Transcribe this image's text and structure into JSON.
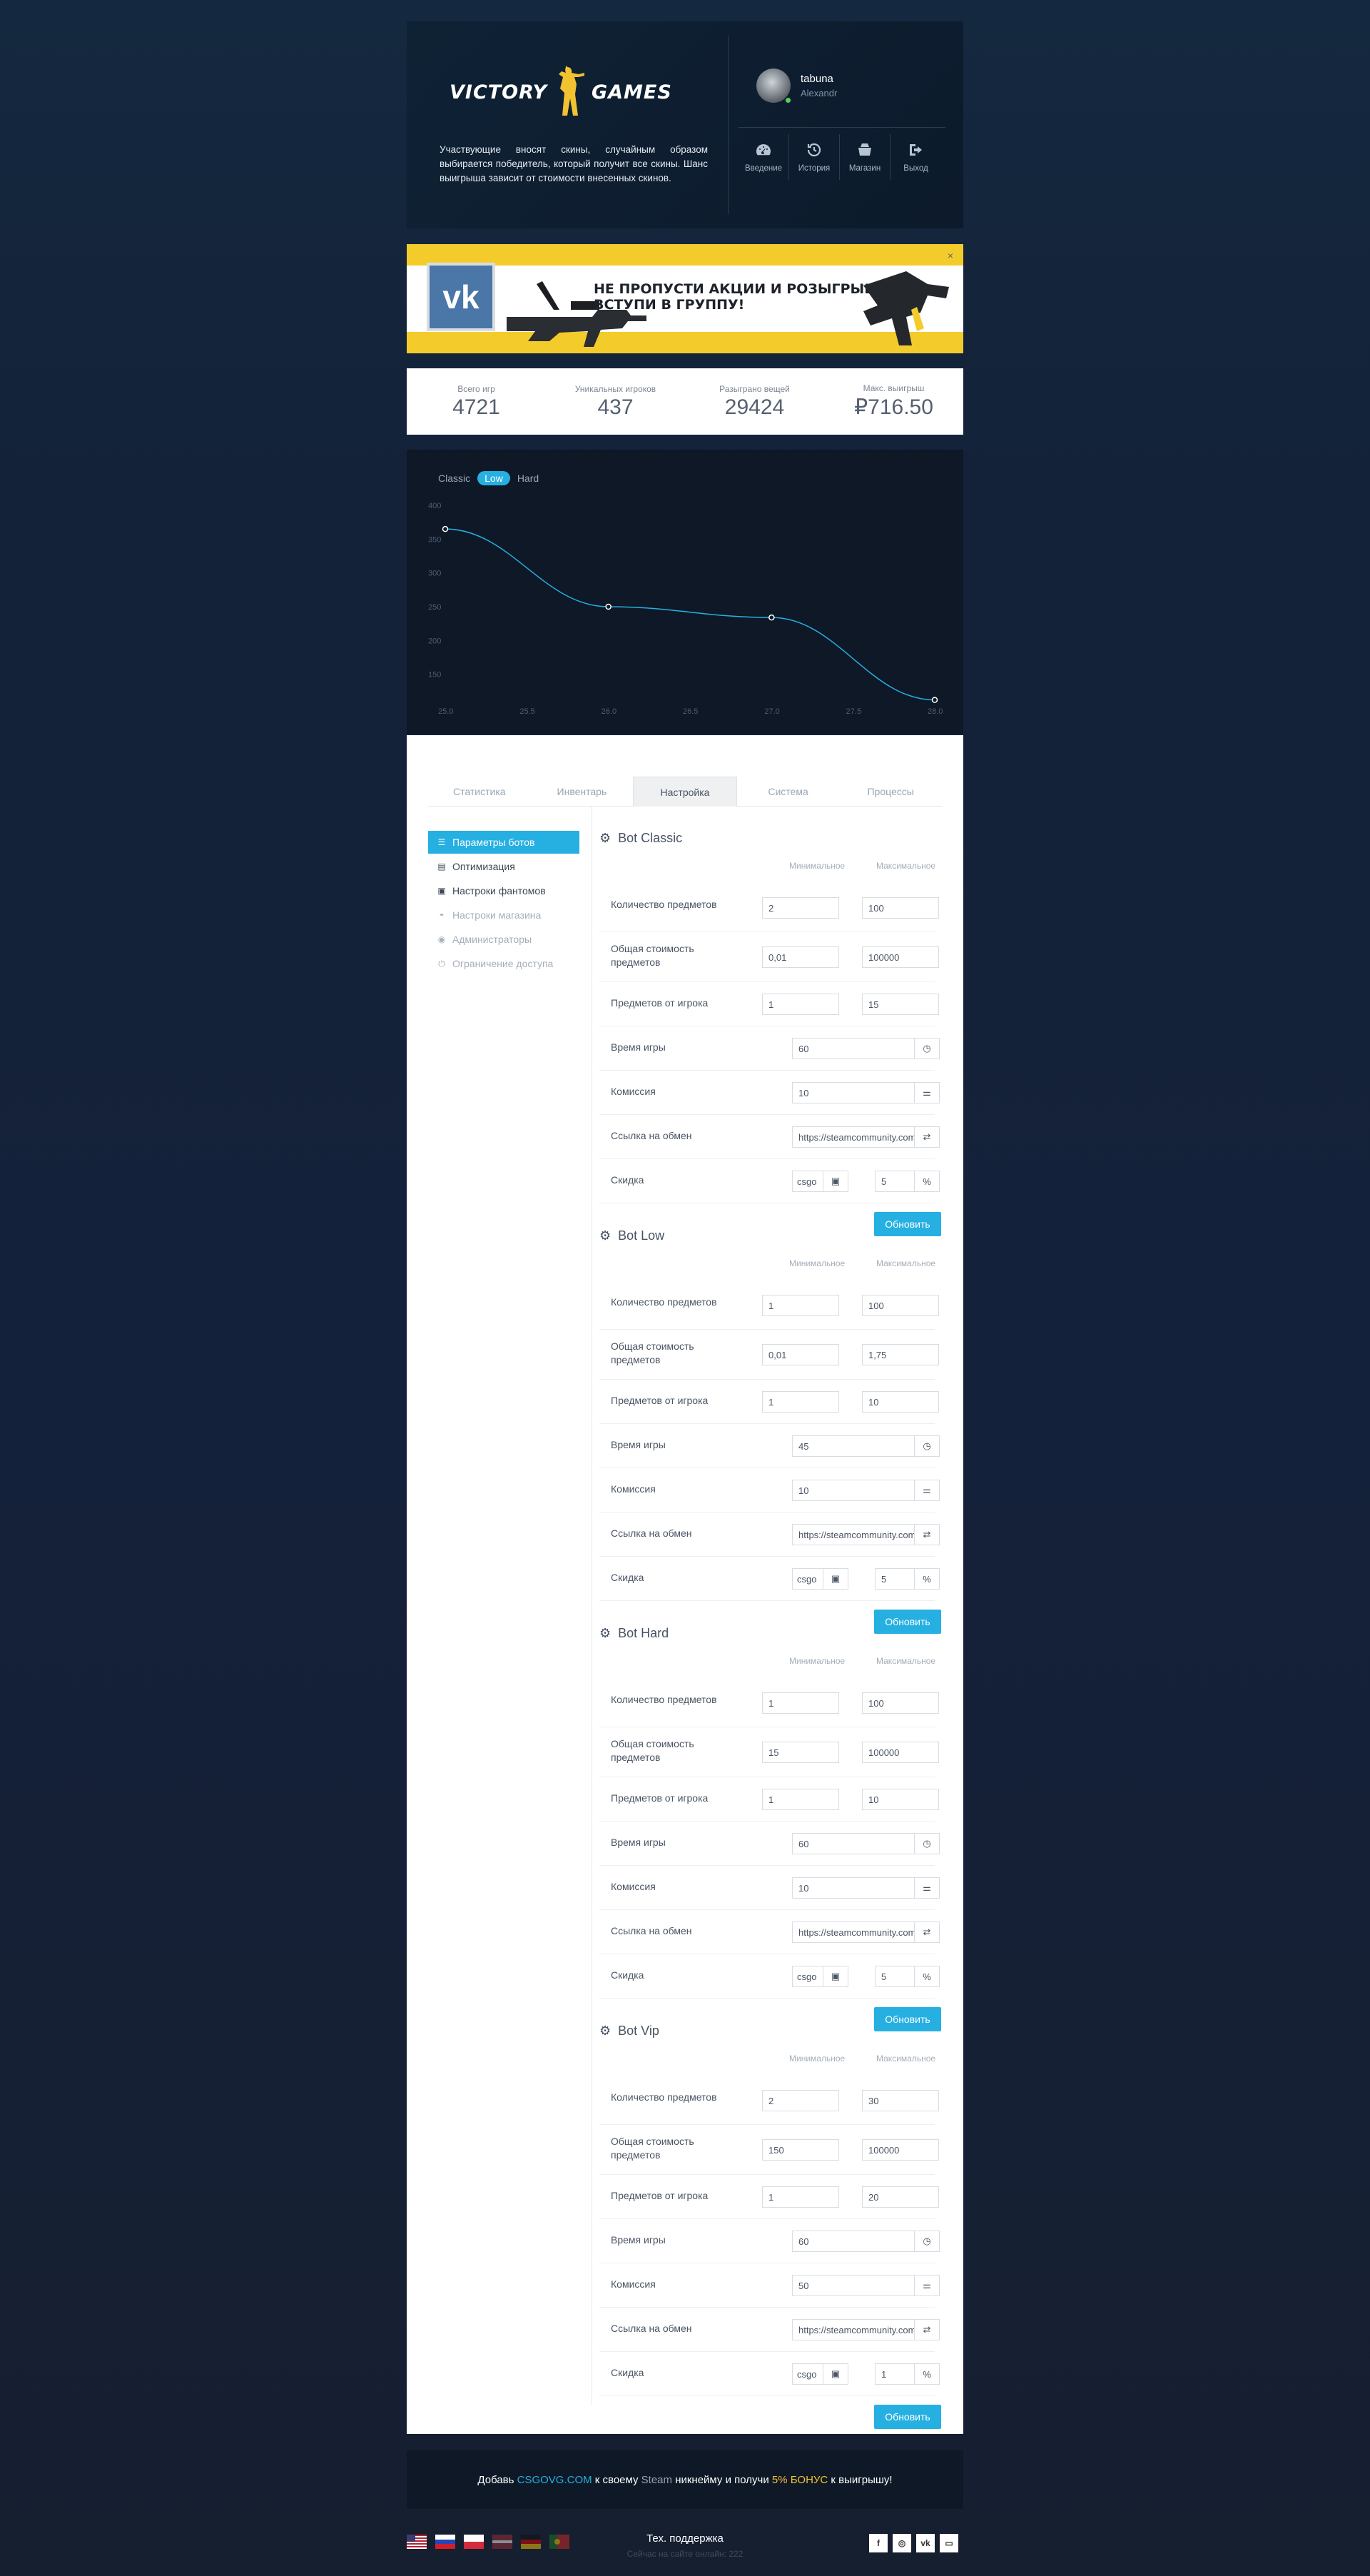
{
  "header": {
    "logo_text": "VICTORY GAMES",
    "description": "Участвующие вносят скины, случайным образом выбирается победитель, который получит все скины. Шанс выигрыша зависит от стоимости внесенных скинов.",
    "user": {
      "name": "tabuna",
      "subname": "Alexandr"
    },
    "nav": [
      {
        "label": "Введение",
        "icon": "dashboard-icon"
      },
      {
        "label": "История",
        "icon": "history-icon"
      },
      {
        "label": "Магазин",
        "icon": "shop-icon"
      },
      {
        "label": "Выход",
        "icon": "logout-icon"
      }
    ]
  },
  "banner": {
    "line1": "НЕ ПРОПУСТИ АКЦИИ И РОЗЫГРЫШИ,",
    "line2": "ВСТУПИ В ГРУППУ!",
    "close": "×"
  },
  "stats": [
    {
      "label": "Всего игр",
      "value": "4721"
    },
    {
      "label": "Уникальных игроков",
      "value": "437"
    },
    {
      "label": "Разыграно вещей",
      "value": "29424"
    },
    {
      "label": "Макс. выигрыш",
      "value": "₽716.50"
    }
  ],
  "chart_modes": [
    "Classic",
    "Low",
    "Hard"
  ],
  "chart_data": {
    "type": "line",
    "x": [
      25.0,
      26.0,
      27.0,
      28.0
    ],
    "series": [
      {
        "values": [
          365,
          250,
          234,
          112
        ]
      }
    ],
    "x_ticks": [
      "25.0",
      "25.5",
      "26.0",
      "26.5",
      "27.0",
      "27.5",
      "28.0"
    ],
    "y_ticks": [
      "150",
      "200",
      "250",
      "300",
      "350",
      "400"
    ],
    "xlim": [
      25.0,
      28.0
    ],
    "ylim": [
      100,
      400
    ],
    "color": "#26b0e2",
    "grid": false
  },
  "tabs": [
    "Статистика",
    "Инвентарь",
    "Настройка",
    "Система",
    "Процессы"
  ],
  "sidebar": [
    {
      "label": "Параметры ботов",
      "icon": "sliders-icon"
    },
    {
      "label": "Оптимизация",
      "icon": "file-icon"
    },
    {
      "label": "Настроки фантомов",
      "icon": "id-card-icon"
    },
    {
      "label": "Настроки магазина",
      "icon": "basket-icon"
    },
    {
      "label": "Администраторы",
      "icon": "users-icon"
    },
    {
      "label": "Ограничение доступа",
      "icon": "power-icon"
    }
  ],
  "col_min": "Минимальное",
  "col_max": "Максимальное",
  "labels": {
    "items_count": "Количество предметов",
    "total_cost": "Общая стоимость предметов",
    "per_player": "Предметов от игрока",
    "game_time": "Время игры",
    "commission": "Комиссия",
    "trade_link": "Ссылка на обмен",
    "discount": "Скидка",
    "update": "Обновить"
  },
  "bots": [
    {
      "title": "Bot Classic",
      "items_min": "2",
      "items_max": "100",
      "cost_min": "0,01",
      "cost_max": "100000",
      "pp_min": "1",
      "pp_max": "15",
      "time": "60",
      "commission": "10",
      "link": "https://steamcommunity.com",
      "disc_site": "csgo",
      "disc_pct": "5"
    },
    {
      "title": "Bot Low",
      "items_min": "1",
      "items_max": "100",
      "cost_min": "0,01",
      "cost_max": "1,75",
      "pp_min": "1",
      "pp_max": "10",
      "time": "45",
      "commission": "10",
      "link": "https://steamcommunity.com",
      "disc_site": "csgo",
      "disc_pct": "5"
    },
    {
      "title": "Bot Hard",
      "items_min": "1",
      "items_max": "100",
      "cost_min": "15",
      "cost_max": "100000",
      "pp_min": "1",
      "pp_max": "10",
      "time": "60",
      "commission": "10",
      "link": "https://steamcommunity.com",
      "disc_site": "csgo",
      "disc_pct": "5"
    },
    {
      "title": "Bot Vip",
      "items_min": "2",
      "items_max": "30",
      "cost_min": "150",
      "cost_max": "100000",
      "pp_min": "1",
      "pp_max": "20",
      "time": "60",
      "commission": "50",
      "link": "https://steamcommunity.com",
      "disc_site": "csgo",
      "disc_pct": "1"
    }
  ],
  "footer": {
    "p1": "Добавь ",
    "site": "CSGOVG.COM",
    "p2": " к своему ",
    "steam": "Steam",
    "p3": " никнейму и получи ",
    "bonus": "5% БОНУС",
    "p4": " к выигрышу!",
    "support": "Тех. поддержка",
    "online": "Сейчас на сайте онлайн: 222",
    "socials": [
      "f",
      "◎",
      "vk",
      "▭"
    ]
  }
}
